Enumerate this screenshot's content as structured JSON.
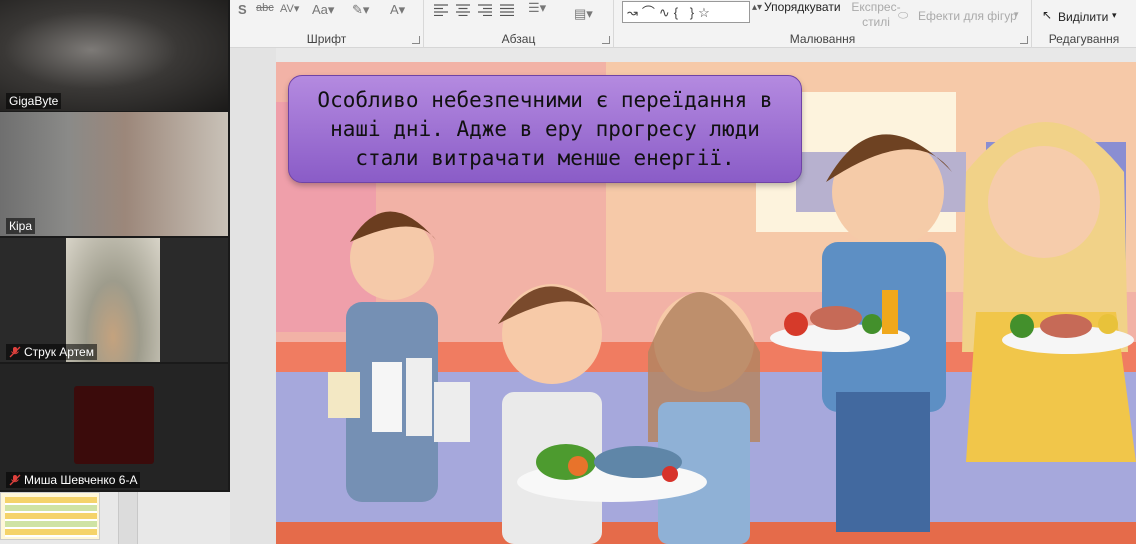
{
  "ribbon": {
    "groups": {
      "font": "Шрифт",
      "paragraph": "Абзац",
      "drawing": "Малювання",
      "editing": "Редагування"
    },
    "arrange_label": "Упорядкувати",
    "express_styles_label": "Експрес-\nстилі",
    "shape_effects_label": "Ефекти для фігур",
    "select_label": "Виділити"
  },
  "participants": [
    {
      "name": "GigaByte",
      "muted": false,
      "active": true
    },
    {
      "name": "Кіра",
      "muted": false,
      "active": false
    },
    {
      "name": "Струк Артем",
      "muted": true,
      "active": false
    },
    {
      "name": "Миша Шевченко 6-А",
      "muted": true,
      "active": false
    }
  ],
  "slide": {
    "caption": "Особливо небезпечними є переїдання в\nнаші дні. Адже в еру прогресу люди\nстали витрачати менше енергії."
  },
  "colors": {
    "active_outline": "#3ad38a",
    "caption_bg": "#9b6fd3",
    "mute_red": "#e0413d"
  }
}
